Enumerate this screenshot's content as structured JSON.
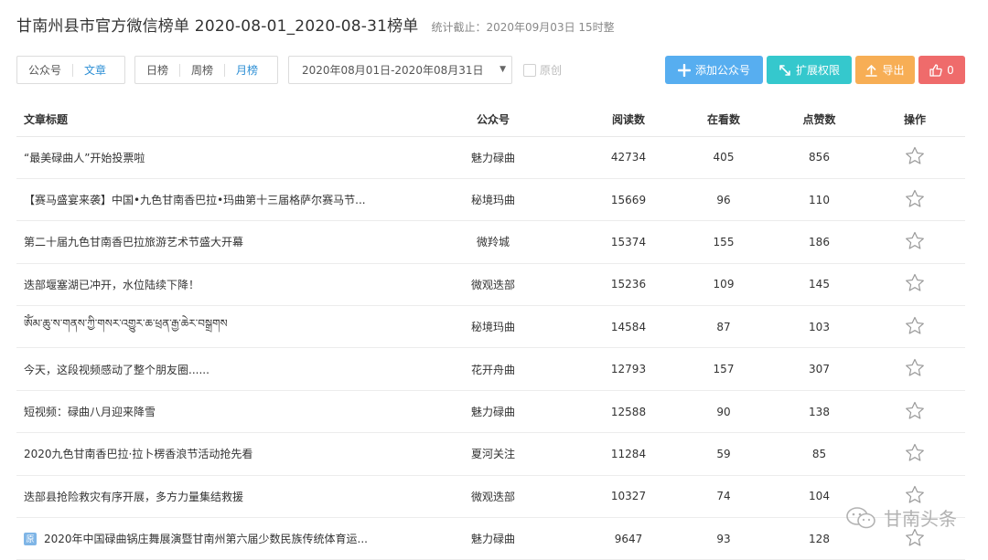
{
  "header": {
    "title": "甘南州县市官方微信榜单 2020-08-01_2020-08-31榜单",
    "stat_note": "统计截止：2020年09月03日 15时整"
  },
  "toolbar": {
    "type_options": [
      "公众号",
      "文章"
    ],
    "type_active": "文章",
    "period_options": [
      "日榜",
      "周榜",
      "月榜"
    ],
    "period_active": "月榜",
    "date_range": "2020年08月01日-2020年08月31日",
    "original_label": "原创",
    "add_label": "添加公众号",
    "expand_label": "扩展权限",
    "export_label": "导出",
    "like_count": "0"
  },
  "table": {
    "headers": [
      "文章标题",
      "公众号",
      "阅读数",
      "在看数",
      "点赞数",
      "操作"
    ],
    "rows": [
      {
        "title": "“最美碌曲人”开始投票啦",
        "account": "魅力碌曲",
        "reads": "42734",
        "looking": "405",
        "likes": "856"
      },
      {
        "title": "【赛马盛宴来袭】中国•九色甘南香巴拉•玛曲第十三届格萨尔赛马节...",
        "account": "秘境玛曲",
        "reads": "15669",
        "looking": "96",
        "likes": "110"
      },
      {
        "title": "第二十届九色甘南香巴拉旅游艺术节盛大开幕",
        "account": "微羚城",
        "reads": "15374",
        "looking": "155",
        "likes": "186"
      },
      {
        "title": "迭部堰塞湖已冲开，水位陆续下降！",
        "account": "微观迭部",
        "reads": "15236",
        "looking": "109",
        "likes": "145"
      },
      {
        "title": "ༀམ་ཆུ་ས་གནས་ཀྱི་གསར་འགྱུར་ཆ་ཕྲན་རྒྱ་ཆེར་བསྒྲགས",
        "account": "秘境玛曲",
        "reads": "14584",
        "looking": "87",
        "likes": "103"
      },
      {
        "title": "今天，这段视频感动了整个朋友圈......",
        "account": "花开舟曲",
        "reads": "12793",
        "looking": "157",
        "likes": "307"
      },
      {
        "title": "短视频：碌曲八月迎来降雪",
        "account": "魅力碌曲",
        "reads": "12588",
        "looking": "90",
        "likes": "138"
      },
      {
        "title": "2020九色甘南香巴拉·拉卜楞香浪节活动抢先看",
        "account": "夏河关注",
        "reads": "11284",
        "looking": "59",
        "likes": "85"
      },
      {
        "title": "迭部县抢险救灾有序开展，多方力量集结救援",
        "account": "微观迭部",
        "reads": "10327",
        "looking": "74",
        "likes": "104"
      },
      {
        "title": "2020年中国碌曲锅庄舞展演暨甘南州第六届少数民族传统体育运...",
        "account": "魅力碌曲",
        "reads": "9647",
        "looking": "93",
        "likes": "128",
        "badge": "原"
      }
    ]
  },
  "watermark": {
    "text": "甘南头条"
  },
  "colors": {
    "accent_blue": "#2d8fd5",
    "btn_add": "#57aef0",
    "btn_expand": "#35c8cd",
    "btn_export": "#f7ae55",
    "btn_like": "#ef6b6b"
  }
}
